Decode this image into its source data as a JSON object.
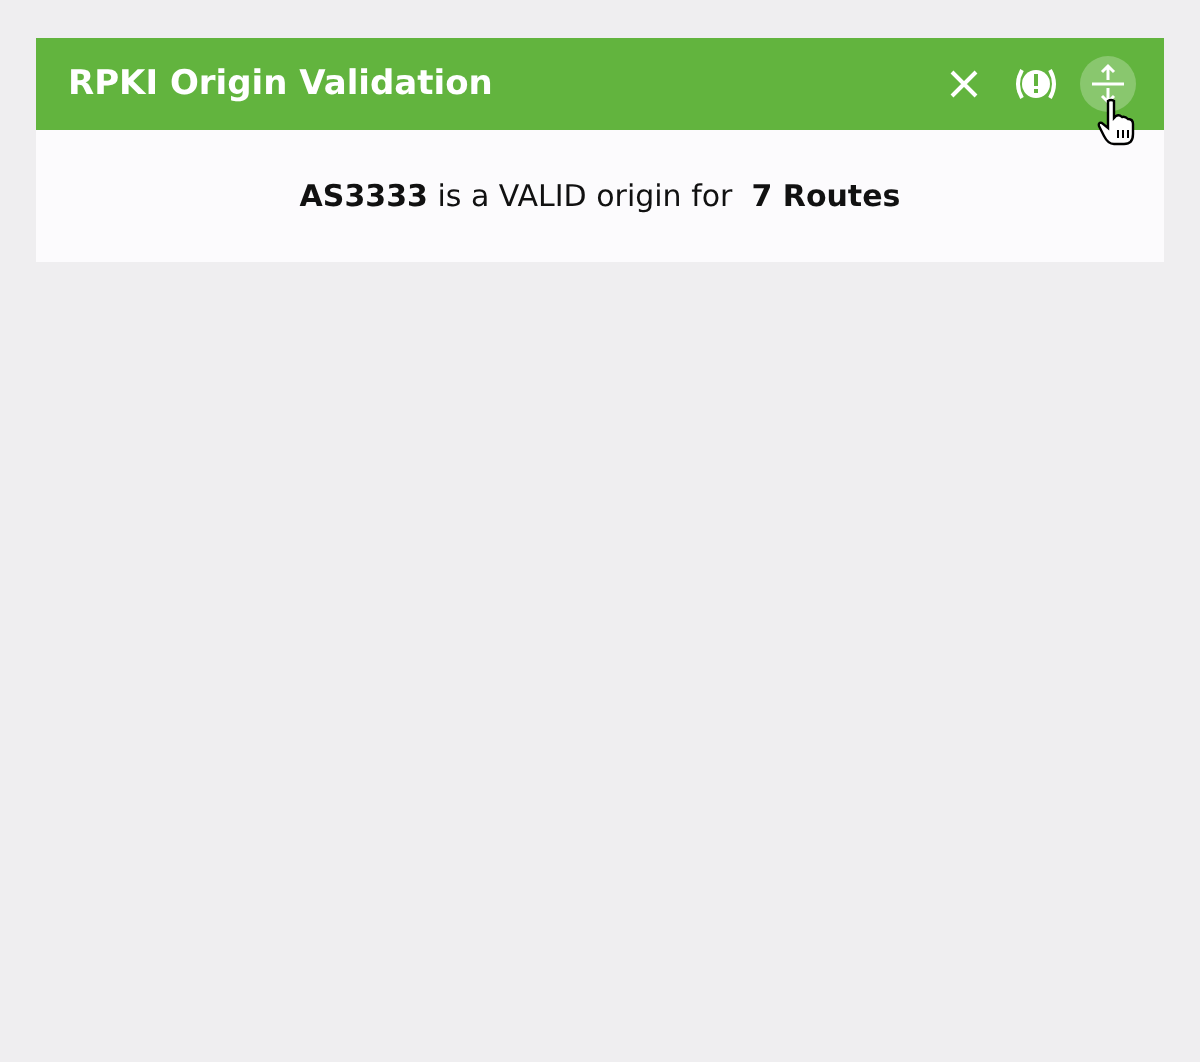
{
  "panel": {
    "title": "RPKI Origin Validation",
    "actions": [
      {
        "kind": "close",
        "hovered": false
      },
      {
        "kind": "alert",
        "hovered": false
      },
      {
        "kind": "collapse",
        "hovered": true
      }
    ],
    "message": "**AS3333** is a VALID origin for  **7 Routes**"
  }
}
